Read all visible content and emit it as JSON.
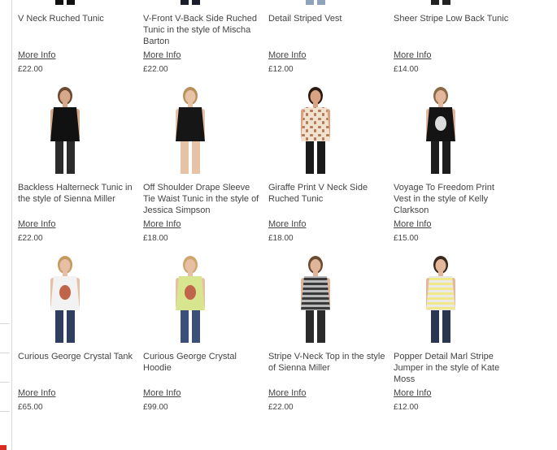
{
  "products": [
    {
      "title": "V Neck Ruched Tunic",
      "more": "More Info",
      "price": "£22.00",
      "top": "#e8c6c0",
      "bottom": "#111111",
      "skin": "#e9c2a6",
      "hair": "#caa46a",
      "pattern": "plain",
      "image": "woman-in-pink-ruched-tunic"
    },
    {
      "title": "V-Front V-Back Side Ruched Tunic in the style of Mischa Barton",
      "more": "More Info",
      "price": "£22.00",
      "top": "#1a1d2a",
      "bottom": "#1a1d2a",
      "skin": "#d9a88c",
      "hair": "#3a2a1c",
      "pattern": "plain",
      "image": "woman-in-navy-tunic"
    },
    {
      "title": "Detail Striped Vest",
      "more": "More Info",
      "price": "£12.00",
      "top": "#ffffff",
      "bottom": "#8fa3bd",
      "skin": "#e0b49a",
      "hair": "#6b4a2c",
      "pattern": "stripes-bw",
      "image": "woman-in-striped-vest"
    },
    {
      "title": "Sheer Stripe Low Back Tunic",
      "more": "More Info",
      "price": "£14.00",
      "top": "#5a5a5a",
      "bottom": "#222222",
      "skin": "#d8ab90",
      "hair": "#4a3424",
      "pattern": "stripes-grey",
      "image": "woman-in-sheer-striped-tunic"
    },
    {
      "title": "Backless Halterneck Tunic in the style of Sienna Miller",
      "more": "More Info",
      "price": "£22.00",
      "top": "#111111",
      "bottom": "#2b2b2b",
      "skin": "#d9a78a",
      "hair": "#6a4a30",
      "pattern": "plain",
      "image": "woman-in-black-backless-tunic"
    },
    {
      "title": "Off Shoulder Drape Sleeve Tie Waist Tunic in the style of Jessica Simpson",
      "more": "More Info",
      "price": "£18.00",
      "top": "#161616",
      "bottom": "#e6c2a6",
      "skin": "#e6c2a6",
      "hair": "#b8915a",
      "pattern": "plain",
      "image": "woman-in-off-shoulder-black-dress"
    },
    {
      "title": "Giraffe Print V Neck Side Ruched Tunic",
      "more": "More Info",
      "price": "£18.00",
      "top": "#b57c5a",
      "bottom": "#1a1a1a",
      "skin": "#d9a383",
      "hair": "#2b1a12",
      "pattern": "giraffe",
      "image": "woman-in-giraffe-print-tunic"
    },
    {
      "title": "Voyage To Freedom Print Vest in the style of Kelly Clarkson",
      "more": "More Info",
      "price": "£15.00",
      "top": "#141414",
      "bottom": "#1d1d1d",
      "skin": "#e3b79c",
      "hair": "#8a6a45",
      "pattern": "print",
      "image": "woman-in-black-print-vest"
    },
    {
      "title": "Curious George Crystal Tank",
      "more": "More Info",
      "price": "£65.00",
      "top": "#f2f2f2",
      "bottom": "#2d3e5e",
      "skin": "#e7bfa4",
      "hair": "#c49a5e",
      "pattern": "print-light",
      "image": "woman-in-white-crystal-tank"
    },
    {
      "title": "Curious George Crystal Hoodie",
      "more": "More Info",
      "price": "£99.00",
      "top": "#d7e58f",
      "bottom": "#3b4f78",
      "skin": "#e7bfa4",
      "hair": "#cda66b",
      "pattern": "print-light",
      "image": "woman-in-green-crystal-hoodie"
    },
    {
      "title": "Stripe V-Neck Top in the style of Sienna Miller",
      "more": "More Info",
      "price": "£22.00",
      "top": "#3a3a3a",
      "bottom": "#2b2b2b",
      "skin": "#e0b59a",
      "hair": "#6a4a30",
      "pattern": "stripes-grey",
      "image": "woman-in-striped-v-neck-top"
    },
    {
      "title": "Popper Detail Marl Stripe Jumper in the style of Kate Moss",
      "more": "More Info",
      "price": "£12.00",
      "top": "#f1e88a",
      "bottom": "#2a3550",
      "skin": "#e3b79c",
      "hair": "#3a2a1c",
      "pattern": "stripes-yellow",
      "image": "woman-in-yellow-striped-jumper"
    }
  ]
}
